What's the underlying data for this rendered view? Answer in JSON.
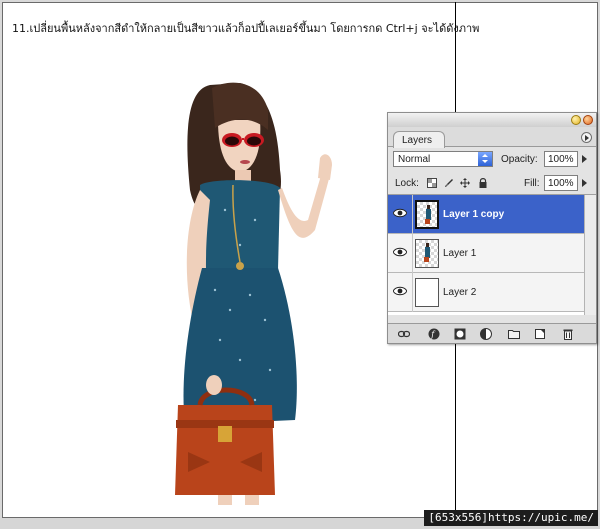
{
  "caption": "11.เปลี่ยนพื้นหลังจากสีดำให้กลายเป็นสีขาวแล้วก็อปปี้เลเยอร์ขึ้นมา โดยการกด Ctrl+j จะได้ดังภาพ",
  "stamp": "[653x556]https://upic.me/",
  "panel": {
    "tab_label": "Layers",
    "blend_mode": "Normal",
    "opacity_label": "Opacity:",
    "opacity_value": "100%",
    "lock_label": "Lock:",
    "fill_label": "Fill:",
    "fill_value": "100%",
    "layers": [
      {
        "name": "Layer 1 copy",
        "selected": true,
        "thumb": "figure"
      },
      {
        "name": "Layer 1",
        "selected": false,
        "thumb": "figure"
      },
      {
        "name": "Layer 2",
        "selected": false,
        "thumb": "white"
      }
    ],
    "icons": {
      "lock_icons": [
        "lock-transparent-icon",
        "lock-brush-icon",
        "lock-move-icon",
        "lock-all-icon"
      ],
      "bottom_icons": [
        "link-layers-icon",
        "layer-style-icon",
        "layer-mask-icon",
        "adjustment-layer-icon",
        "new-group-icon",
        "new-layer-icon",
        "delete-layer-icon"
      ]
    },
    "colors": {
      "selection": "#3b62c9",
      "close": "#e0641d",
      "minimize": "#e4b422"
    }
  }
}
